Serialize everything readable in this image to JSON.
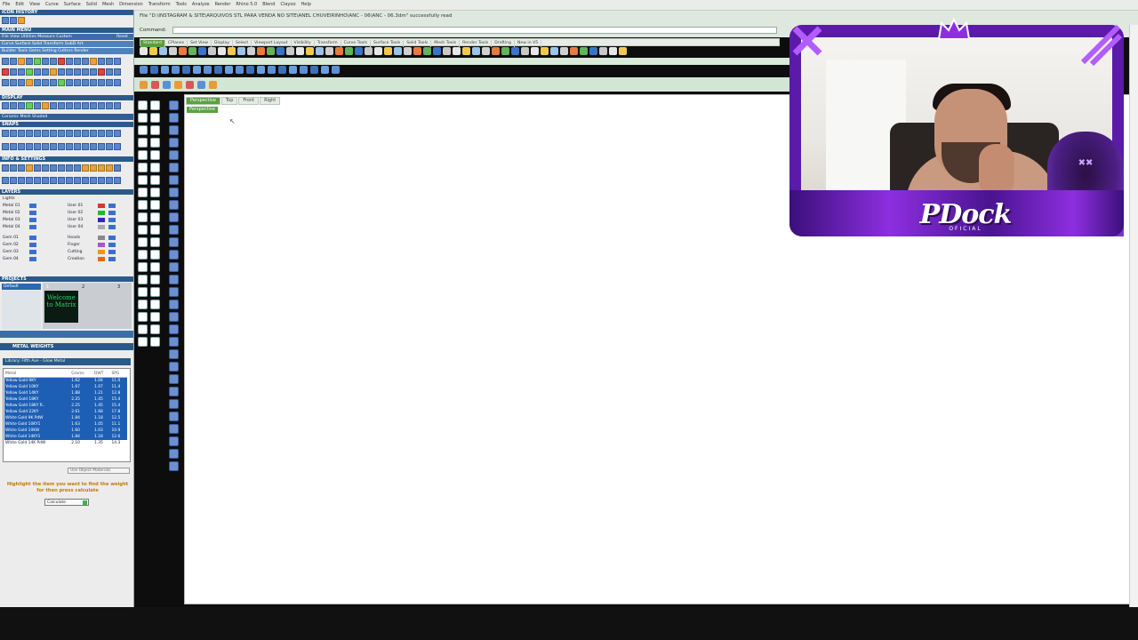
{
  "menubar": {
    "items": [
      "File",
      "Edit",
      "View",
      "Curve",
      "Surface",
      "Solid",
      "Mesh",
      "Dimension",
      "Transform",
      "Tools",
      "Analyze",
      "Render",
      "Rhino 5.0",
      "Blend",
      "Clayoo",
      "Help"
    ]
  },
  "left_panel": {
    "icon_history": "ICON HISTORY",
    "main_menu": "MAIN MENU",
    "menu_row1": "File  View  Utilities  Measure  Custom",
    "menu_reset": "Reset",
    "menu_row2": "Curve  Surface  Solid  Transform  SubD  Art",
    "menu_row3": "Builder  Tools  Gems  Setting  Cutters  Render",
    "display": "DISPLAY",
    "display_tabs": "Ceramic Mesh      Shaded",
    "snaps": "SNAPS",
    "info_settings": "INFO & SETTINGS",
    "layers": "LAYERS",
    "layers_header": "Lights",
    "layers_left": [
      "Metal 01",
      "Metal 02",
      "Metal 03",
      "Metal 04",
      "Gem 01",
      "Gem 02",
      "Gem 03",
      "Gem 04"
    ],
    "layers_right": [
      "User 01",
      "User 02",
      "User 03",
      "User 04",
      "Heads",
      "Finger",
      "Cutting",
      "Creation"
    ],
    "projects": "PROJECTS",
    "projects_default": "Default",
    "projects_col1": "1",
    "projects_col2": "2",
    "projects_col3": "3",
    "projects_thumb": "Welcome to Matrix",
    "metal_weights": "METAL WEIGHTS",
    "library": "Library: Fifth Ave - Glow Metal",
    "table_headers": [
      "Metal",
      "Grams",
      "DWT",
      "SPG"
    ],
    "table_rows": [
      [
        "Yellow Gold 9KY",
        "1.62",
        "1.04",
        "11.0"
      ],
      [
        "Yellow Gold 10KY",
        "1.67",
        "1.07",
        "11.4"
      ],
      [
        "Yellow Gold 14KY",
        "1.88",
        "1.21",
        "12.8"
      ],
      [
        "Yellow Gold 18KY",
        "2.25",
        "1.45",
        "15.4"
      ],
      [
        "Yellow Gold 18KY R..",
        "2.25",
        "1.45",
        "15.4"
      ],
      [
        "Yellow Gold 22KY",
        "2.61",
        "1.68",
        "17.8"
      ],
      [
        "White Gold 9K PdW",
        "1.84",
        "1.18",
        "12.5"
      ],
      [
        "White Gold 10KY1",
        "1.63",
        "1.05",
        "11.1"
      ],
      [
        "White Gold 10KW",
        "1.60",
        "1.03",
        "10.9"
      ],
      [
        "White Gold 14KY1",
        "1.84",
        "1.18",
        "12.6"
      ],
      [
        "White Gold 14K PdW",
        "2.10",
        "1.35",
        "14.3"
      ]
    ],
    "use_object_materials": "Use Object Materials",
    "hint": "Highlight the item you want to find the weight for then press calculate",
    "calculate": "Calculate"
  },
  "main": {
    "status_line": "File \"D:\\INSTAGRAM & SITE\\ARQUIVOS STL PARA VENDA NO SITE\\ANEL CHUVEIRINHO\\ANC - 06\\ANC - 06.3dm\" successfully read",
    "command_label": "Command:",
    "tabs": [
      "Standard",
      "CPlanes",
      "Set View",
      "Display",
      "Select",
      "Viewport Layout",
      "Visibility",
      "Transform",
      "Curve Tools",
      "Surface Tools",
      "Solid Tools",
      "Mesh Tools",
      "Render Tools",
      "Drafting",
      "New in V5"
    ],
    "viewport_tabs": [
      "Perspective",
      "Top",
      "Front",
      "Right"
    ],
    "viewport_label": "Perspective"
  },
  "webcam": {
    "brand": "PDock",
    "brand_sub": "OFICIAL"
  },
  "colors": {
    "accent_green": "#5aa043",
    "panel_blue": "#2a5a8a",
    "overlay_purple": "#5b1aa8",
    "hint_orange": "#c47b00"
  }
}
